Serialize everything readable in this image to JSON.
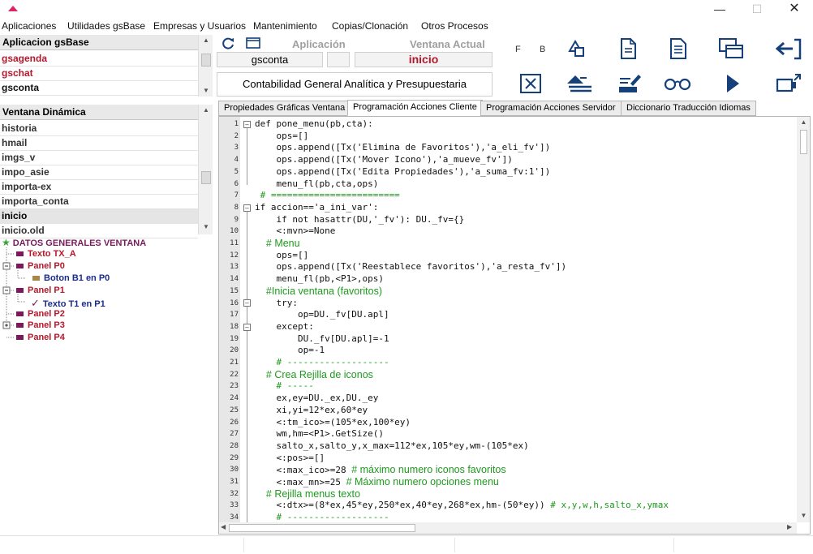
{
  "menu": [
    "Aplicaciones",
    "Utilidades gsBase",
    "Empresas y Usuarios",
    "Mantenimiento",
    "Copias/Clonación",
    "Otros Procesos"
  ],
  "apps": {
    "header": "Aplicacion gsBase",
    "items": [
      {
        "label": "gsagenda",
        "color": "red"
      },
      {
        "label": "gschat",
        "color": "red"
      },
      {
        "label": "gsconta",
        "color": "black"
      }
    ]
  },
  "windows": {
    "header": "Ventana Dinámica",
    "items": [
      "historia",
      "hmail",
      "imgs_v",
      "impo_asie",
      "importa-ex",
      "importa_conta",
      "inicio",
      "inicio.old"
    ],
    "selected": "inicio"
  },
  "tree": {
    "root": "DATOS GENERALES VENTANA",
    "nodes": [
      {
        "label": "Texto TX_A",
        "color": "#b4182c"
      },
      {
        "label": "Panel P0",
        "color": "#b4182c"
      },
      {
        "label": "Boton B1 en P0",
        "color": "#1b2c8a"
      },
      {
        "label": "Panel P1",
        "color": "#b4182c"
      },
      {
        "label": "Texto T1 en P1",
        "color": "#1b2c8a"
      },
      {
        "label": "Panel P2",
        "color": "#b4182c"
      },
      {
        "label": "Panel P3",
        "color": "#b4182c"
      },
      {
        "label": "Panel P4",
        "color": "#b4182c"
      }
    ]
  },
  "toolbar": {
    "app_label": "Aplicación",
    "window_label": "Ventana Actual",
    "app_value": "gsconta",
    "window_value": "inicio",
    "description": "Contabilidad General Analítica y Presupuestaria",
    "f_label": "F",
    "b_label": "B"
  },
  "tabs": [
    "Propiedades Gráficas Ventana",
    "Programación Acciones Cliente",
    "Programación Acciones Servidor",
    "Diccionario Traducción Idiomas"
  ],
  "active_tab": 1,
  "code": [
    {
      "n": "1",
      "t": "def pone_menu(pb,cta):",
      "k": "code"
    },
    {
      "n": "2",
      "t": "    ops=[]",
      "k": "code"
    },
    {
      "n": "3",
      "t": "    ops.append([Tx('Elimina de Favoritos'),'a_eli_fv'])",
      "k": "code"
    },
    {
      "n": "4",
      "t": "    ops.append([Tx('Mover Icono'),'a_mueve_fv'])",
      "k": "code"
    },
    {
      "n": "5",
      "t": "    ops.append([Tx('Edita Propiedades'),'a_suma_fv:1'])",
      "k": "code"
    },
    {
      "n": "6",
      "t": "    menu_fl(pb,cta,ops)",
      "k": "code"
    },
    {
      "n": "7",
      "t": " # ========================",
      "k": "cmmono"
    },
    {
      "n": "8",
      "t": "if accion=='a_ini_var':",
      "k": "code"
    },
    {
      "n": "9",
      "t": "    if not hasattr(DU,'_fv'): DU._fv={}",
      "k": "code"
    },
    {
      "n": "10",
      "t": "    <:mvn>=None",
      "k": "code"
    },
    {
      "n": "11",
      "t": "    # Menu",
      "k": "cm"
    },
    {
      "n": "12",
      "t": "    ops=[]",
      "k": "code"
    },
    {
      "n": "13",
      "t": "    ops.append([Tx('Reestablece favoritos'),'a_resta_fv'])",
      "k": "code"
    },
    {
      "n": "14",
      "t": "    menu_fl(pb,<P1>,ops)",
      "k": "code"
    },
    {
      "n": "15",
      "t": "    #Inicia ventana (favoritos)",
      "k": "cm"
    },
    {
      "n": "16",
      "t": "    try:",
      "k": "code"
    },
    {
      "n": "17",
      "t": "        op=DU._fv[DU.apl]",
      "k": "code"
    },
    {
      "n": "18",
      "t": "    except:",
      "k": "code"
    },
    {
      "n": "19",
      "t": "        DU._fv[DU.apl]=-1",
      "k": "code"
    },
    {
      "n": "20",
      "t": "        op=-1",
      "k": "code"
    },
    {
      "n": "21",
      "t": "    # -------------------",
      "k": "cmmono"
    },
    {
      "n": "22",
      "t": "    # Crea Rejilla de iconos",
      "k": "cm"
    },
    {
      "n": "23",
      "t": "    # -----",
      "k": "cmmono"
    },
    {
      "n": "24",
      "t": "    ex,ey=DU._ex,DU._ey",
      "k": "code"
    },
    {
      "n": "25",
      "t": "    xi,yi=12*ex,60*ey",
      "k": "code"
    },
    {
      "n": "26",
      "t": "    <:tm_ico>=(105*ex,100*ey)",
      "k": "code"
    },
    {
      "n": "27",
      "t": "    wm,hm=<P1>.GetSize()",
      "k": "code"
    },
    {
      "n": "28",
      "t": "    salto_x,salto_y,x_max=112*ex,105*ey,wm-(105*ex)",
      "k": "code"
    },
    {
      "n": "29",
      "t": "    <:pos>=[]",
      "k": "code"
    },
    {
      "n": "30",
      "t": "    <:max_ico>=28 # máximo numero iconos favoritos",
      "k": "mixed1"
    },
    {
      "n": "31",
      "t": "    <:max_mn>=25 # Máximo numero opciones menu",
      "k": "mixed2"
    },
    {
      "n": "32",
      "t": "    # Rejilla menus texto",
      "k": "cm"
    },
    {
      "n": "33",
      "t": "    <:dtx>=(8*ex,45*ey,250*ex,40*ey,268*ex,hm-(50*ey)) # x,y,w,h,salto_x,ymax",
      "k": "mixed3"
    },
    {
      "n": "34",
      "t": "    # -------------------",
      "k": "cmmono"
    }
  ],
  "colors": {
    "accent": "#16407a",
    "red": "#b4182c",
    "comment": "#1e9a1e",
    "logo": "#e0255e"
  }
}
